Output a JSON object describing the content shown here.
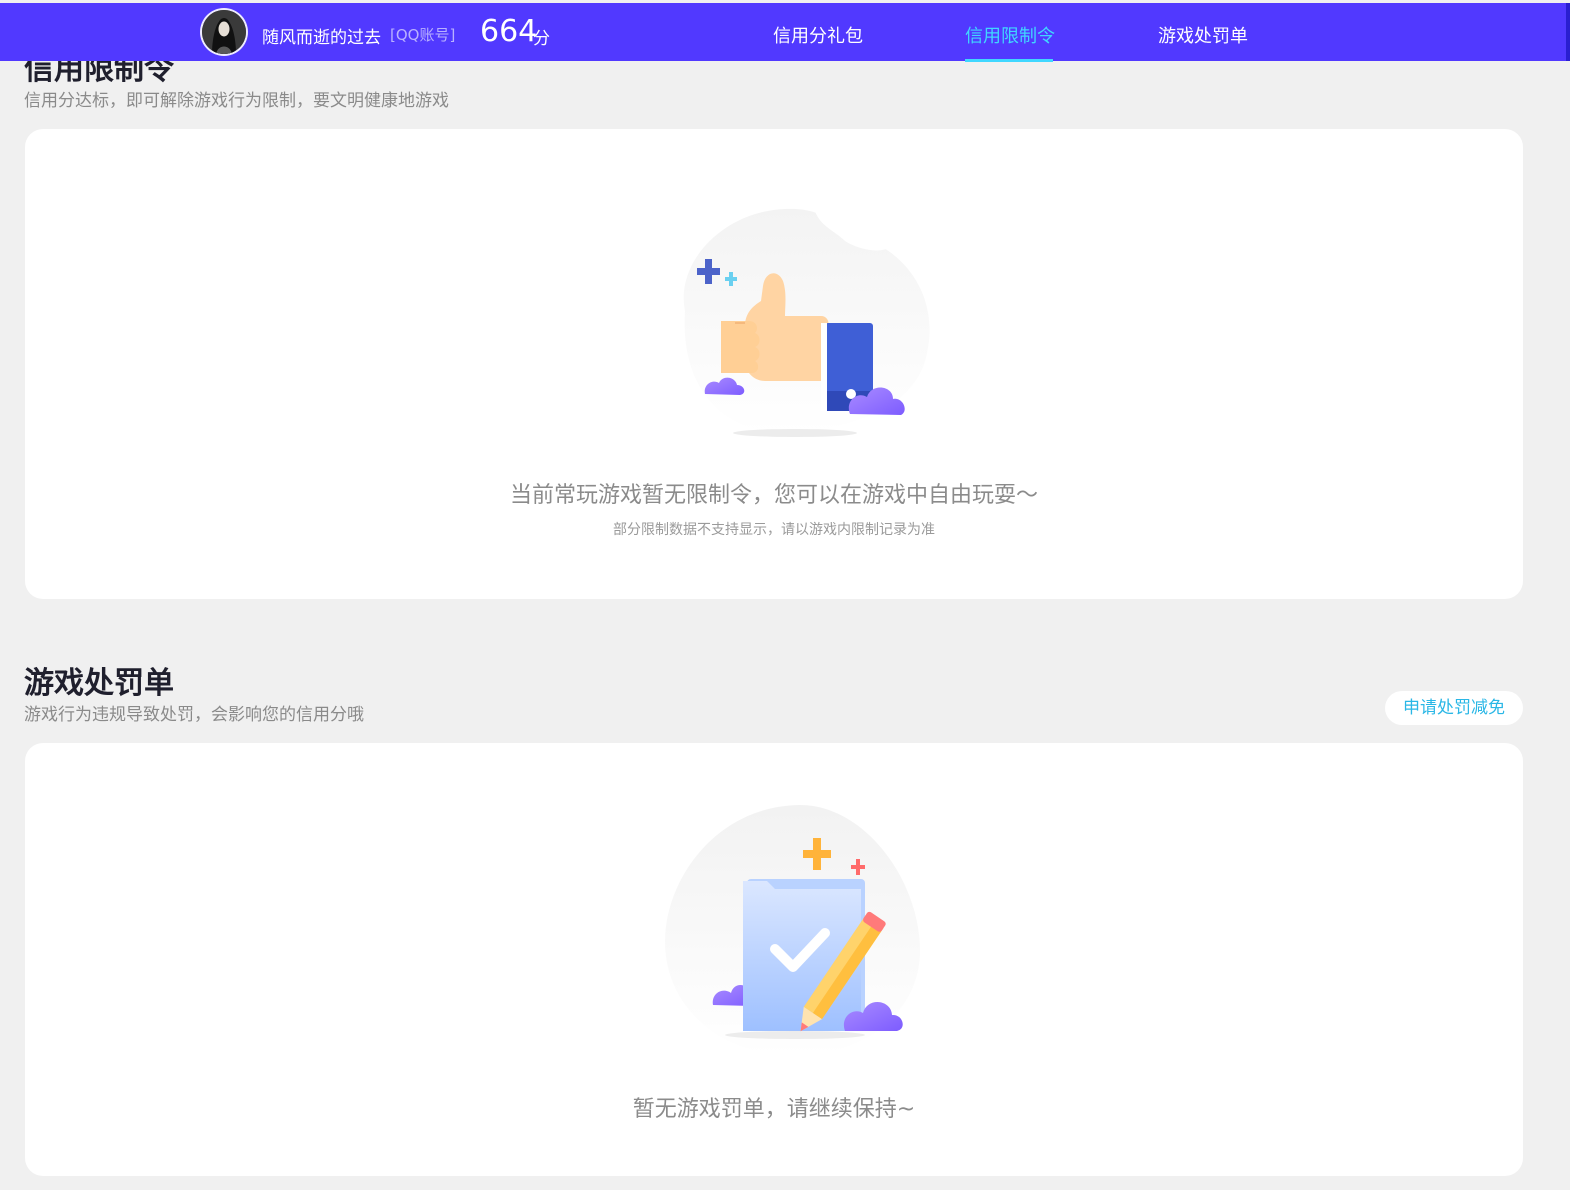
{
  "header": {
    "username": "随风而逝的过去",
    "account_type": "[QQ账号]",
    "score": "664",
    "score_unit": "分",
    "tabs": [
      {
        "label": "信用分礼包",
        "active": false
      },
      {
        "label": "信用限制令",
        "active": true
      },
      {
        "label": "游戏处罚单",
        "active": false
      }
    ],
    "colors": {
      "bar": "#5139ff",
      "active_tab": "#40d7ff"
    }
  },
  "restriction": {
    "title": "信用限制令",
    "subtitle": "信用分达标，即可解除游戏行为限制，要文明健康地游戏",
    "empty_message": "当前常玩游戏暂无限制令，您可以在游戏中自由玩耍～",
    "note": "部分限制数据不支持显示，请以游戏内限制记录为准",
    "illustration": "thumbs-up-icon"
  },
  "penalty": {
    "title": "游戏处罚单",
    "subtitle": "游戏行为违规导致处罚，会影响您的信用分哦",
    "appeal_button": "申请处罚减免",
    "empty_message": "暂无游戏罚单，请继续保持~",
    "illustration": "checklist-pencil-icon"
  }
}
